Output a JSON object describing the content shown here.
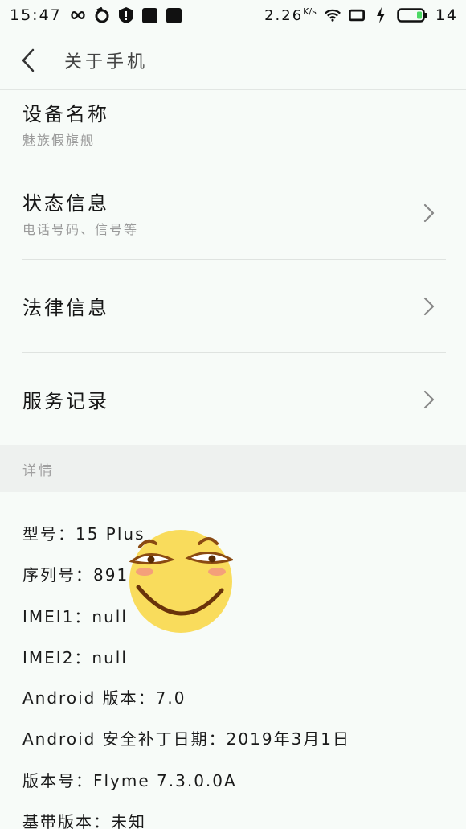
{
  "status_bar": {
    "time": "15:47",
    "speed_value": "2.26",
    "speed_unit": "K/s",
    "battery_level": "14",
    "icons": [
      "infinity-icon",
      "sync-icon",
      "shield-icon",
      "qq-icon",
      "mail-icon",
      "wifi-icon",
      "screen-icon",
      "charging-icon",
      "battery-icon"
    ]
  },
  "header": {
    "title": "关于手机"
  },
  "menu": {
    "device_name": {
      "title": "设备名称",
      "subtitle": "魅族假旗舰"
    },
    "status_info": {
      "title": "状态信息",
      "subtitle": "电话号码、信号等"
    },
    "legal_info": {
      "title": "法律信息"
    },
    "service_record": {
      "title": "服务记录"
    }
  },
  "section": {
    "details_label": "详情"
  },
  "details": {
    "model": "型号：15 Plus",
    "serial": "序列号：891",
    "imei1": "IMEI1：null",
    "imei2": "IMEI2：null",
    "android_version": "Android 版本：7.0",
    "security_patch": "Android 安全补丁日期：2019年3月1日",
    "build_number": "版本号：Flyme 7.3.0.0A",
    "baseband": "基带版本：未知"
  },
  "colors": {
    "background": "#f7fbf8",
    "section_bg": "#eef1ef",
    "emoji_yellow": "#f9dc5c",
    "battery_green": "#4cd964"
  }
}
